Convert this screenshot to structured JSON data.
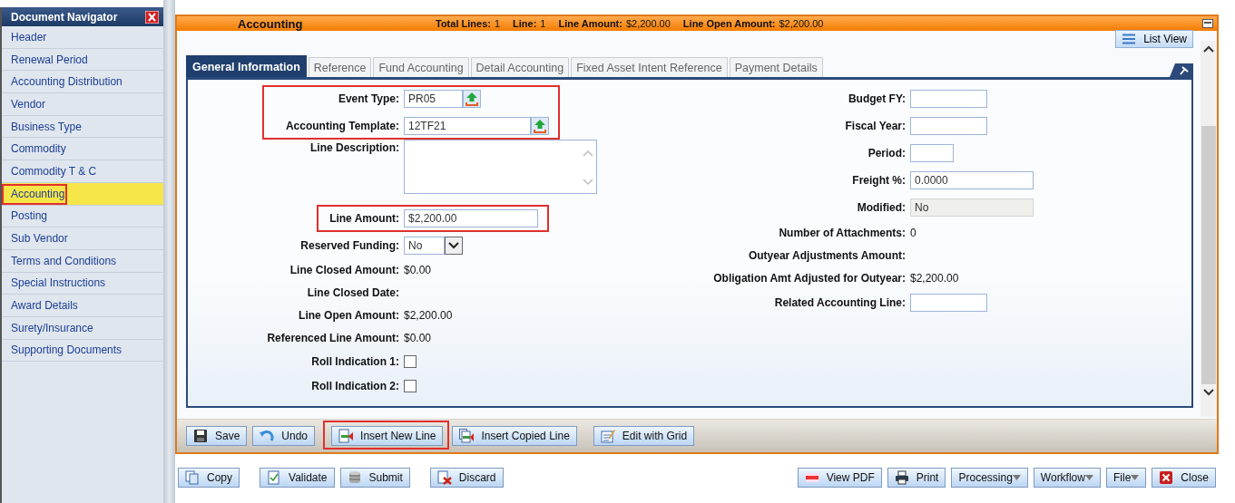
{
  "navigator": {
    "title": "Document Navigator",
    "items": [
      {
        "label": "Header",
        "selected": false,
        "highlighted": false
      },
      {
        "label": "Renewal Period",
        "selected": false,
        "highlighted": false
      },
      {
        "label": "Accounting Distribution",
        "selected": false,
        "highlighted": false
      },
      {
        "label": "Vendor",
        "selected": false,
        "highlighted": false
      },
      {
        "label": "Business Type",
        "selected": false,
        "highlighted": false
      },
      {
        "label": "Commodity",
        "selected": false,
        "highlighted": false
      },
      {
        "label": "Commodity T & C",
        "selected": false,
        "highlighted": false
      },
      {
        "label": "Accounting",
        "selected": true,
        "highlighted": true
      },
      {
        "label": "Posting",
        "selected": false,
        "highlighted": false
      },
      {
        "label": "Sub Vendor",
        "selected": false,
        "highlighted": false
      },
      {
        "label": "Terms and Conditions",
        "selected": false,
        "highlighted": false
      },
      {
        "label": "Special Instructions",
        "selected": false,
        "highlighted": false
      },
      {
        "label": "Award Details",
        "selected": false,
        "highlighted": false
      },
      {
        "label": "Surety/Insurance",
        "selected": false,
        "highlighted": false
      },
      {
        "label": "Supporting Documents",
        "selected": false,
        "highlighted": false
      }
    ]
  },
  "header": {
    "title": "Accounting",
    "stats": [
      {
        "label": "Total Lines:",
        "value": "1"
      },
      {
        "label": "Line:",
        "value": "1"
      },
      {
        "label": "Line Amount:",
        "value": "$2,200.00"
      },
      {
        "label": "Line Open Amount:",
        "value": "$2,200.00"
      }
    ]
  },
  "list_view_button": "List View",
  "tabs": [
    {
      "label": "General Information",
      "selected": true
    },
    {
      "label": "Reference",
      "selected": false
    },
    {
      "label": "Fund Accounting",
      "selected": false
    },
    {
      "label": "Detail Accounting",
      "selected": false
    },
    {
      "label": "Fixed Asset Intent Reference",
      "selected": false
    },
    {
      "label": "Payment Details",
      "selected": false
    }
  ],
  "left_fields": [
    {
      "kind": "picker",
      "label": "Event Type:",
      "value": "PR05",
      "highlighted": true
    },
    {
      "kind": "picker",
      "label": "Accounting Template:",
      "value": "12TF21",
      "highlighted": true
    },
    {
      "kind": "textarea",
      "label": "Line Description:",
      "highlighted": false
    },
    {
      "kind": "input",
      "label": "Line Amount:",
      "value": "$2,200.00",
      "highlighted": true
    },
    {
      "kind": "select",
      "label": "Reserved Funding:",
      "value": "No",
      "highlighted": false
    },
    {
      "kind": "text",
      "label": "Line Closed Amount:",
      "value": "$0.00",
      "highlighted": false
    },
    {
      "kind": "text",
      "label": "Line Closed Date:",
      "highlighted": false
    },
    {
      "kind": "text",
      "label": "Line Open Amount:",
      "value": "$2,200.00",
      "highlighted": false
    },
    {
      "kind": "text",
      "label": "Referenced Line Amount:",
      "value": "$0.00",
      "highlighted": false
    },
    {
      "kind": "checkbox",
      "label": "Roll Indication 1:",
      "checked": false,
      "highlighted": false
    },
    {
      "kind": "checkbox",
      "label": "Roll Indication 2:",
      "checked": false,
      "highlighted": false
    }
  ],
  "right_fields": [
    {
      "kind": "input",
      "label": "Budget FY:"
    },
    {
      "kind": "input",
      "label": "Fiscal Year:"
    },
    {
      "kind": "input",
      "label": "Period:"
    },
    {
      "kind": "input",
      "label": "Freight %:",
      "value": "0.0000"
    },
    {
      "kind": "readonly",
      "label": "Modified:",
      "value": "No"
    },
    {
      "kind": "text",
      "label": "Number of Attachments:",
      "value": "0"
    },
    {
      "kind": "text",
      "label": "Outyear Adjustments Amount:"
    },
    {
      "kind": "text",
      "label": "Obligation Amt Adjusted for Outyear:",
      "value": "$2,200.00"
    },
    {
      "kind": "input",
      "label": "Related Accounting Line:"
    }
  ],
  "toolbar": [
    {
      "kind": "save",
      "label": "Save",
      "highlighted": false
    },
    {
      "kind": "undo",
      "label": "Undo",
      "highlighted": false
    },
    {
      "kind": "insert",
      "label": "Insert New Line",
      "highlighted": true
    },
    {
      "kind": "insert_copy",
      "label": "Insert Copied Line",
      "highlighted": false
    },
    {
      "kind": "grid",
      "label": "Edit with Grid",
      "highlighted": false
    }
  ],
  "actions_left": [
    {
      "kind": "copy",
      "label": "Copy"
    },
    {
      "kind": "validate",
      "label": "Validate"
    },
    {
      "kind": "submit",
      "label": "Submit"
    },
    {
      "kind": "discard",
      "label": "Discard"
    }
  ],
  "actions_right": [
    {
      "kind": "pdf",
      "label": "View PDF"
    },
    {
      "kind": "print",
      "label": "Print"
    },
    {
      "kind": "menu",
      "label": "Processing"
    },
    {
      "kind": "menu",
      "label": "Workflow"
    },
    {
      "kind": "menu",
      "label": "File"
    },
    {
      "kind": "close",
      "label": "Close"
    }
  ]
}
